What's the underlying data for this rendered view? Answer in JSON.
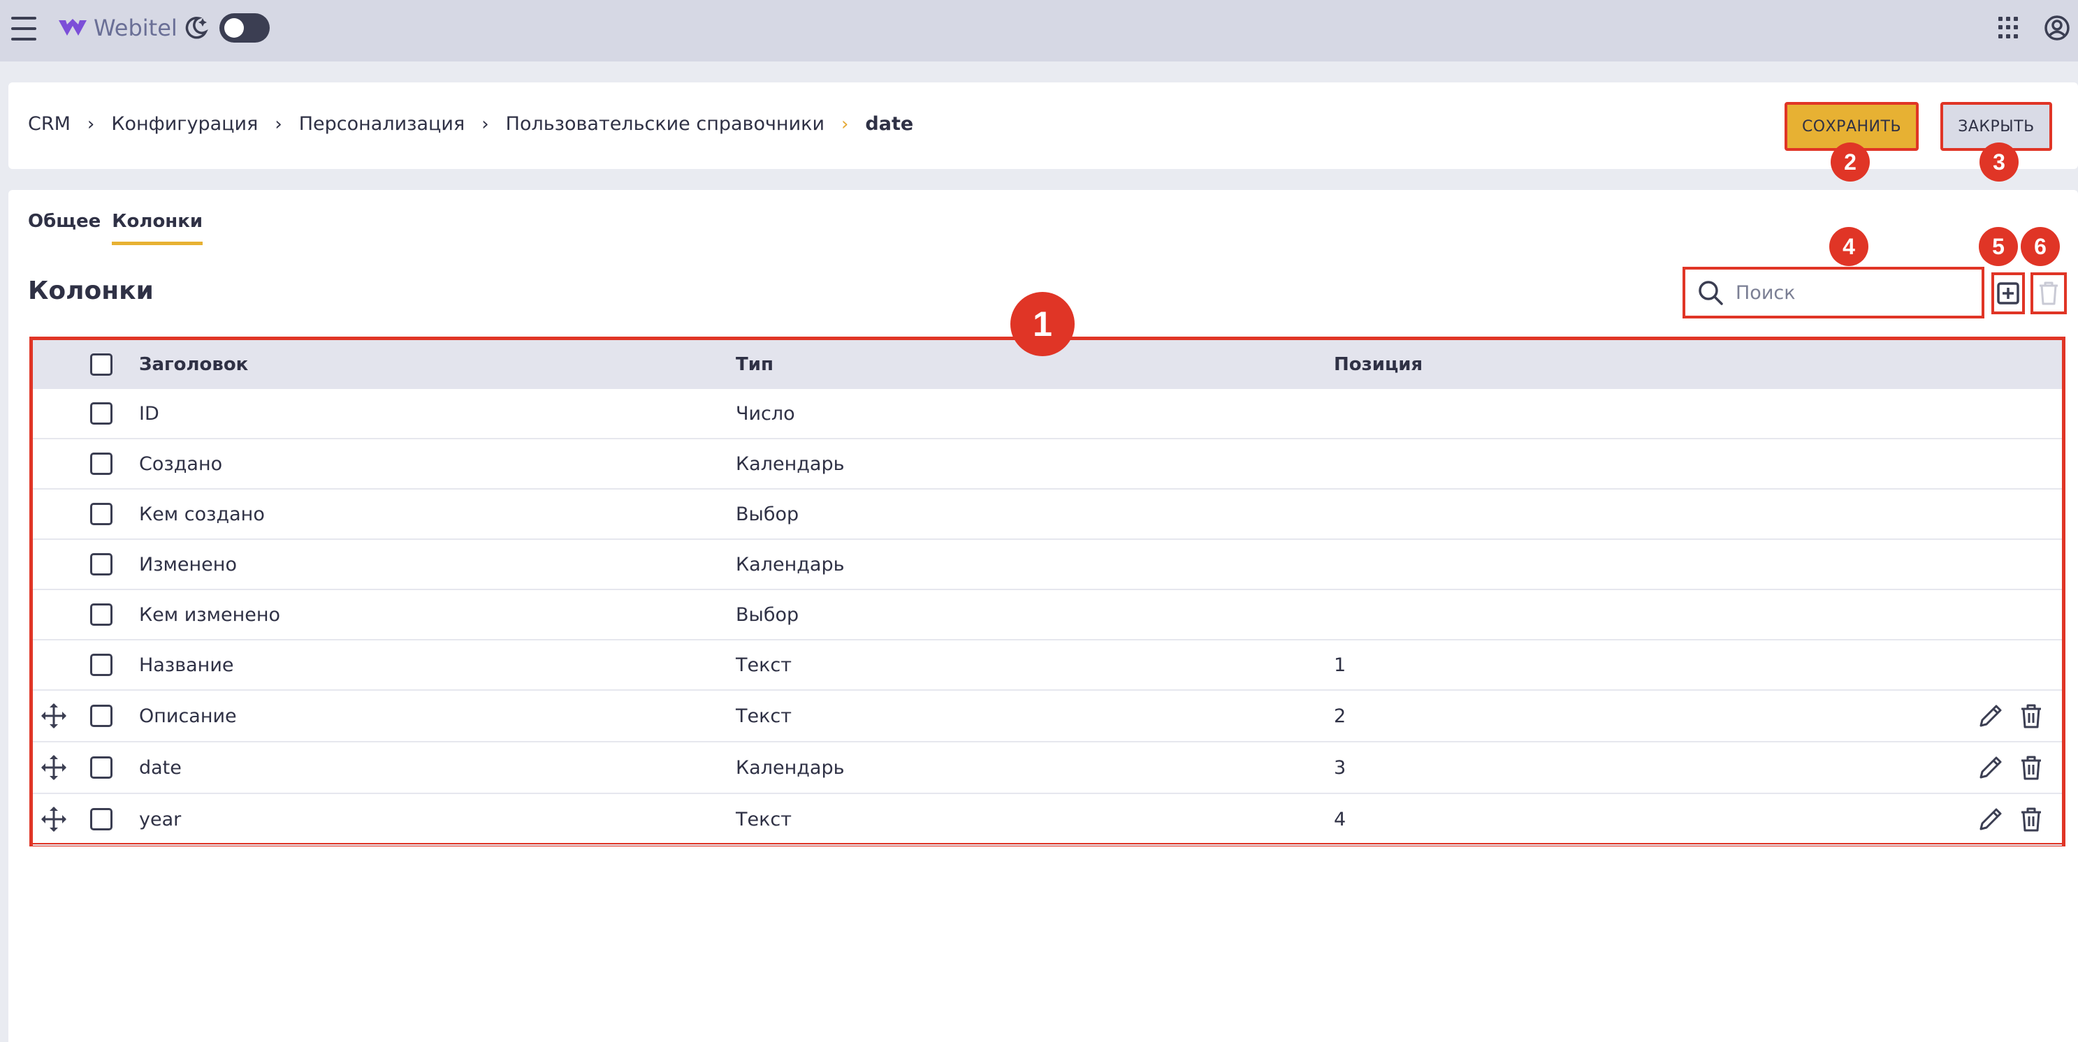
{
  "topbar": {
    "logo_text": "Webitel"
  },
  "breadcrumb": [
    "CRM",
    "Конфигурация",
    "Персонализация",
    "Пользовательские справочники",
    "date"
  ],
  "actions": {
    "save_label": "СОХРАНИТЬ",
    "close_label": "ЗАКРЫТЬ"
  },
  "tabs": [
    {
      "label": "Общее",
      "active": false
    },
    {
      "label": "Колонки",
      "active": true
    }
  ],
  "section": {
    "title": "Колонки"
  },
  "search": {
    "placeholder": "Поиск"
  },
  "table": {
    "headers": {
      "title": "Заголовок",
      "type": "Тип",
      "position": "Позиция"
    },
    "rows": [
      {
        "title": "ID",
        "type": "Число",
        "position": "",
        "editable": false
      },
      {
        "title": "Создано",
        "type": "Календарь",
        "position": "",
        "editable": false
      },
      {
        "title": "Кем создано",
        "type": "Выбор",
        "position": "",
        "editable": false
      },
      {
        "title": "Изменено",
        "type": "Календарь",
        "position": "",
        "editable": false
      },
      {
        "title": "Кем изменено",
        "type": "Выбор",
        "position": "",
        "editable": false
      },
      {
        "title": "Название",
        "type": "Текст",
        "position": "1",
        "editable": false
      },
      {
        "title": "Описание",
        "type": "Текст",
        "position": "2",
        "editable": true
      },
      {
        "title": "date",
        "type": "Календарь",
        "position": "3",
        "editable": true
      },
      {
        "title": "year",
        "type": "Текст",
        "position": "4",
        "editable": true
      }
    ]
  },
  "annotations": {
    "table": "1",
    "save": "2",
    "close": "3",
    "search": "4",
    "add": "5",
    "delete": "6"
  },
  "colors": {
    "accent": "#e7b133",
    "annotation": "#e03526",
    "topbar": "#d6d8e4",
    "text": "#2f3145"
  },
  "icons": [
    "menu-icon",
    "webitel-logo-icon",
    "moon-icon",
    "apps-grid-icon",
    "account-icon",
    "search-icon",
    "plus-square-icon",
    "trash-icon",
    "move-icon",
    "pencil-icon"
  ]
}
